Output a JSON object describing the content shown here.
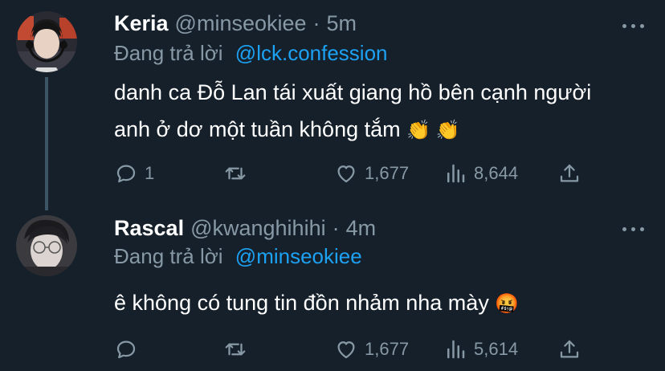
{
  "tweets": [
    {
      "display_name": "Keria",
      "handle": "@minseokiee",
      "time": "5m",
      "reply_label": "Đang trả lời",
      "reply_to": "@lck.confession",
      "text_line1": "danh ca Đỗ Lan tái xuất giang hồ bên cạnh người",
      "text_line2": "anh ở dơ một tuần không tắm",
      "emojis": "👏 👏",
      "replies": "1",
      "retweets": "",
      "likes": "1,677",
      "views": "8,644"
    },
    {
      "display_name": "Rascal",
      "handle": "@kwanghihihi",
      "time": "4m",
      "reply_label": "Đang trả lời",
      "reply_to": "@minseokiee",
      "text_line1": "ê không có tung tin đồn nhảm nha mày",
      "emojis": "🤬",
      "replies": "",
      "retweets": "",
      "likes": "1,677",
      "views": "5,614"
    }
  ],
  "icons": {
    "reply": "reply-icon",
    "retweet": "retweet-icon",
    "like": "heart-icon",
    "views": "views-icon",
    "share": "share-icon",
    "more": "more-icon"
  },
  "colors": {
    "background": "#15202b",
    "text": "#ffffff",
    "secondary": "#8899a6",
    "link": "#1da1f2",
    "thread_line": "#3d5466"
  }
}
